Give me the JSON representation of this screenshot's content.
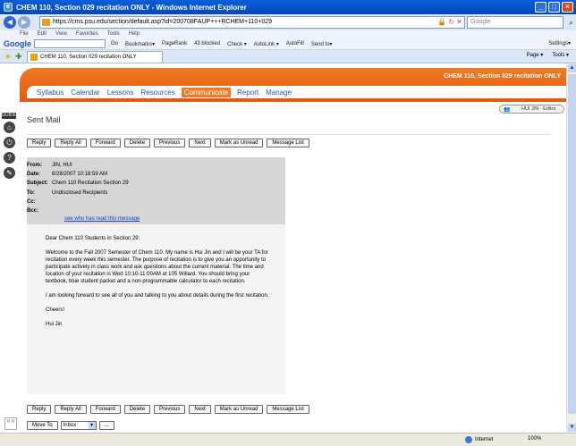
{
  "window": {
    "title": "CHEM 110, Section 029 recitation ONLY - Windows Internet Explorer"
  },
  "browser": {
    "address": "https://cms.psu.edu/section/default.asp?id=200708FAUP+++RCHEM+110+029",
    "search_placeholder": "Google",
    "menu": [
      "File",
      "Edit",
      "View",
      "Favorites",
      "Tools",
      "Help"
    ],
    "google_toolbar": {
      "logo": "Google",
      "go": "Go",
      "items": [
        "Bookmarks▾",
        "PageRank",
        "43 blocked",
        "Check ▾",
        "AutoLink ▾",
        "AutoFill",
        "Send to▾"
      ],
      "settings": "Settings▾"
    },
    "tab_title": "CHEM 110, Section 029 recitation ONLY",
    "tab_tools": [
      "Page ▾",
      "Tools ▾"
    ],
    "status": {
      "zone": "Internet",
      "zoom": "100%"
    }
  },
  "lms": {
    "course_title": "CHEM 110, Section 029 recitation ONLY",
    "nav": [
      "Syllabus",
      "Calendar",
      "Lessons",
      "Resources",
      "Communicate",
      "Report",
      "Manage"
    ],
    "active_nav": "Communicate",
    "editor_label": "HUI JIN - Editor",
    "guide_label": "GUIDE"
  },
  "page": {
    "title": "Sent Mail",
    "buttons": [
      "Reply",
      "Reply All",
      "Forward",
      "Delete",
      "Previous",
      "Next",
      "Mark as Unread",
      "Message List"
    ],
    "move_to": "Move To",
    "folder": "Inbox",
    "ellipsis": "..."
  },
  "message": {
    "from_label": "From:",
    "from": "JIN, HUI",
    "date_label": "Date:",
    "date": "8/28/2007 10:18:59 AM",
    "subject_label": "Subject:",
    "subject": "Chem 110 Recitation Section 29",
    "to_label": "To:",
    "to": "Undisclosed Recipients",
    "cc_label": "Cc:",
    "cc": "",
    "bcc_label": "Bcc:",
    "bcc": "",
    "see_who": "see who has read this message",
    "body": [
      "Dear Chem 110 Students in Section 29:",
      "Welcome to the Fall 2007 Semester of Chem 110.  My name is Hui Jin and I will be your TA for recitation every week this semester.  The purpose of recitation is to give you an opportunity to participate actively in class work and ask questions about the current material.  The time and location of your recitation is Wed 10:10-11:00AM at 105 Willard. You should bring your textbook, blue student packet and a non-programmable calculator to each recitation.",
      "I am looking forward to see all of you and talking to you about details during the first recitation.",
      "Cheers!",
      "Hui Jin"
    ]
  }
}
